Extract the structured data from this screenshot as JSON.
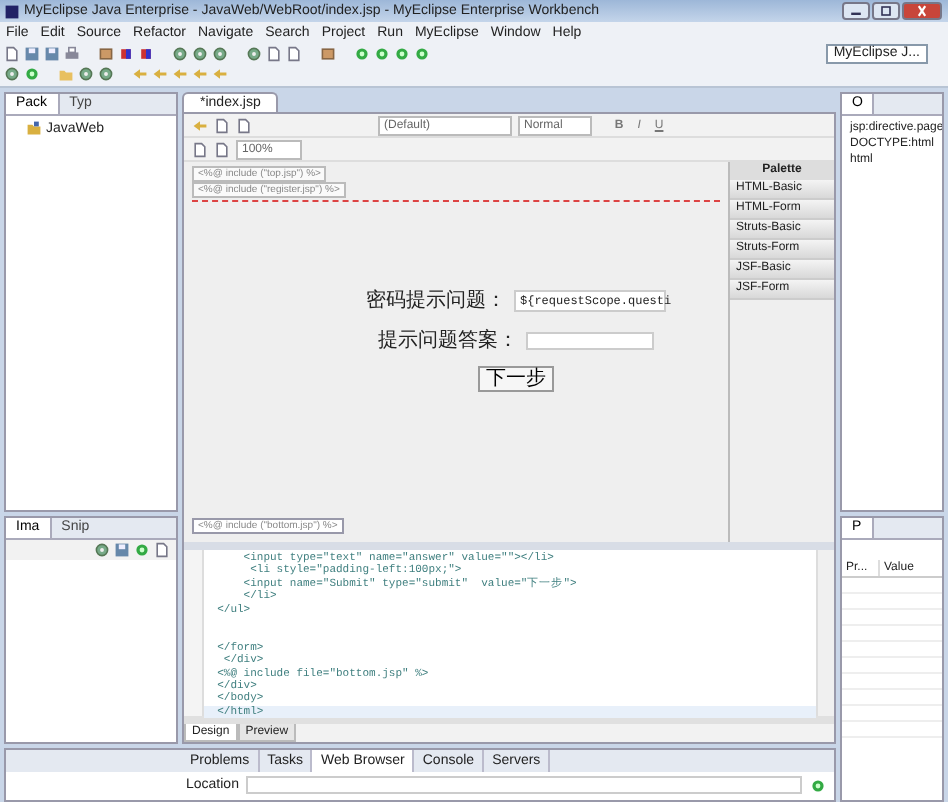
{
  "window": {
    "title": "MyEclipse Java Enterprise - JavaWeb/WebRoot/index.jsp - MyEclipse Enterprise Workbench"
  },
  "menu": [
    "File",
    "Edit",
    "Source",
    "Refactor",
    "Navigate",
    "Search",
    "Project",
    "Run",
    "MyEclipse",
    "Window",
    "Help"
  ],
  "perspective": "MyEclipse J...",
  "left_views": [
    {
      "label": "Pack",
      "selected": true
    },
    {
      "label": "Typ",
      "selected": false
    }
  ],
  "tree": [
    {
      "label": "JavaWeb"
    }
  ],
  "editor_tab": "*index.jsp",
  "design_toolbar": {
    "zoom": "100%",
    "style": "(Default)",
    "format": "Normal",
    "bold": "B",
    "italic": "I",
    "underline": "U"
  },
  "design": {
    "includes_top": [
      "<%@ include (\"top.jsp\") %>",
      "<%@ include (\"register.jsp\") %>"
    ],
    "fields": [
      {
        "label": "密码提示问题：",
        "kind": "tag",
        "value": "${requestScope.questi"
      },
      {
        "label": "提示问题答案：",
        "kind": "text"
      }
    ],
    "submit": "下一步",
    "include_bottom": "<%@ include (\"bottom.jsp\") %>"
  },
  "palette": {
    "title": "Palette",
    "drawers": [
      "HTML-Basic",
      "HTML-Form",
      "Struts-Basic",
      "Struts-Form",
      "JSF-Basic",
      "JSF-Form"
    ]
  },
  "outline": {
    "label": "O",
    "items": [
      "jsp:directive.page",
      "DOCTYPE:html",
      "html"
    ]
  },
  "lower_left_views": [
    {
      "label": "Ima",
      "selected": true
    },
    {
      "label": "Snip",
      "selected": false
    }
  ],
  "source": {
    "lines": [
      {
        "kind": "code",
        "text": "      <input type=\"text\" name=\"answer\" value=\"\"></li>"
      },
      {
        "kind": "code",
        "text": "       <li style=\"padding-left:100px;\">"
      },
      {
        "kind": "code",
        "text": "      <input name=\"Submit\" type=\"submit\"  value=\"下一步\">"
      },
      {
        "kind": "code",
        "text": "      </li>"
      },
      {
        "kind": "code",
        "text": "  </ul>"
      },
      {
        "kind": "blank"
      },
      {
        "kind": "blank"
      },
      {
        "kind": "code",
        "text": "  </form>"
      },
      {
        "kind": "code",
        "text": "   </div>"
      },
      {
        "kind": "code",
        "text": "  <%@ include file=\"bottom.jsp\" %>"
      },
      {
        "kind": "code",
        "text": "  </div>"
      },
      {
        "kind": "code",
        "text": "  </body>"
      },
      {
        "kind": "code",
        "text": "  </html>"
      }
    ]
  },
  "source_tabs": [
    {
      "label": "Design",
      "selected": true
    },
    {
      "label": "Preview",
      "selected": false
    }
  ],
  "properties": {
    "label": "P",
    "columns": [
      "Pr...",
      "Value"
    ]
  },
  "bottom_tabs": [
    {
      "label": "Problems",
      "selected": false
    },
    {
      "label": "Tasks",
      "selected": false
    },
    {
      "label": "Web Browser",
      "selected": true
    },
    {
      "label": "Console",
      "selected": false
    },
    {
      "label": "Servers",
      "selected": false
    }
  ],
  "location_label": "Location"
}
